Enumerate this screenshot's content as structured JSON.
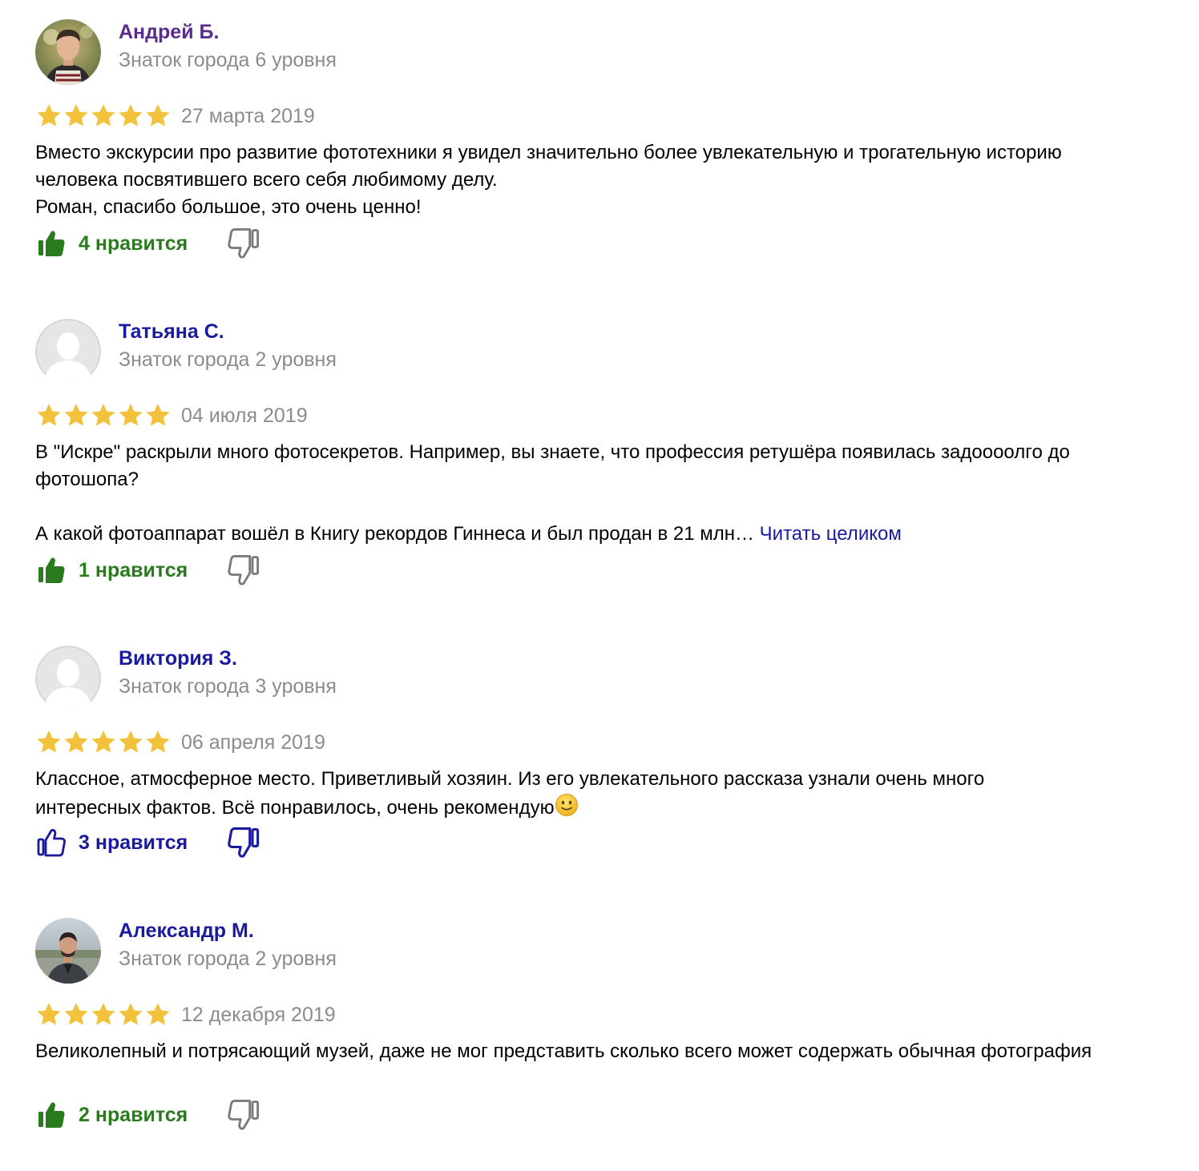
{
  "colors": {
    "name_visited": "#5a2d8c",
    "name_link": "#1a1a9e",
    "secondary_text": "#8c8c8c",
    "star": "#f3c23d",
    "like_green": "#2a7a1e",
    "like_blue": "#1a1a9e",
    "dislike_gray": "#7a7a7a",
    "dislike_blue": "#1a1a9e"
  },
  "reviews": [
    {
      "author": "Андрей Б.",
      "level": "Знаток города 6 уровня",
      "avatar": "user-photo",
      "rating": 5,
      "date": "27 марта 2019",
      "paragraphs": [
        "Вместо экскурсии про развитие фототехники я увидел значительно более увлекательную и трогательную историю человека посвятившего всего себя любимому делу.",
        "Роман, спасибо большое, это очень ценно!"
      ],
      "likes": "4 нравится",
      "like_icon": "thumbs-up-filled-icon",
      "dislike_icon": "thumbs-down-outline-icon"
    },
    {
      "author": "Татьяна С.",
      "level": "Знаток города 2 уровня",
      "avatar": "default-avatar",
      "rating": 5,
      "date": "04 июля 2019",
      "paragraphs": [
        "В \"Искре\" раскрыли много фотосекретов. Например, вы знаете, что профессия ретушёра появилась задоооолго до фотошопа?",
        "А какой фотоаппарат вошёл в Книгу рекордов Гиннеса и был продан в 21 млн…"
      ],
      "read_more": "Читать целиком",
      "likes": "1 нравится",
      "like_icon": "thumbs-up-filled-icon",
      "dislike_icon": "thumbs-down-outline-icon"
    },
    {
      "author": "Виктория З.",
      "level": "Знаток города 3 уровня",
      "avatar": "default-avatar",
      "rating": 5,
      "date": "06 апреля 2019",
      "paragraphs": [
        "Классное, атмосферное место. Приветливый хозяин. Из его увлекательного рассказа узнали очень много интересных фактов. Всё понравилось, очень рекомендую"
      ],
      "emoji": "slightly-smiling-face-icon",
      "likes": "3 нравится",
      "like_icon": "thumbs-up-outline-icon",
      "dislike_icon": "thumbs-down-outline-icon"
    },
    {
      "author": "Александр М.",
      "level": "Знаток города 2 уровня",
      "avatar": "user-photo",
      "rating": 5,
      "date": "12 декабря 2019",
      "paragraphs": [
        "Великолепный и потрясающий музей, даже не мог представить сколько всего может содержать обычная фотография"
      ],
      "likes": "2 нравится",
      "like_icon": "thumbs-up-filled-icon",
      "dislike_icon": "thumbs-down-outline-icon"
    }
  ]
}
